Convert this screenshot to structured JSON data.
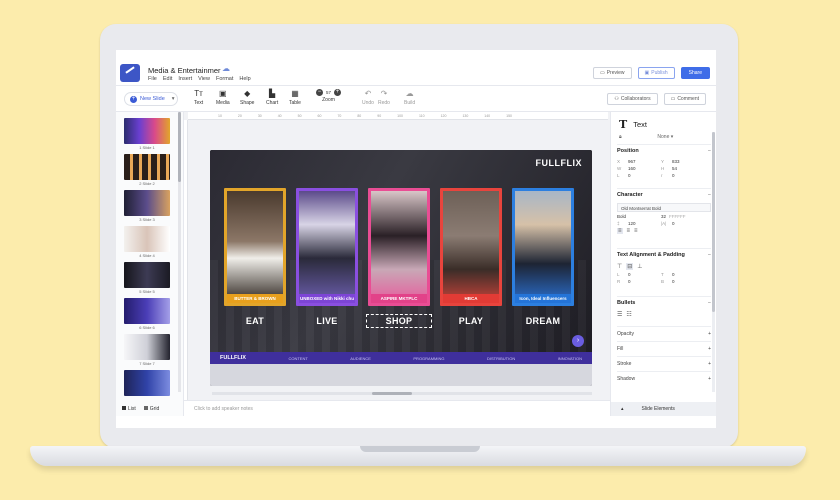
{
  "doc": {
    "title": "Media & Entertainmer"
  },
  "menu": [
    "File",
    "Edit",
    "Insert",
    "View",
    "Format",
    "Help"
  ],
  "top_actions": {
    "preview": "Preview",
    "publish": "Publish",
    "share": "Share"
  },
  "toolbar": {
    "new_slide": "New Slide",
    "text": "Text",
    "media": "Media",
    "shape": "Shape",
    "chart": "Chart",
    "table": "Table",
    "zoom_label": "Zoom",
    "zoom_value": "57",
    "undo": "Undo",
    "redo": "Redo",
    "build": "Build",
    "collaborators": "Collaborators",
    "comment": "Comment"
  },
  "slides": [
    {
      "label": "1 Slide 1"
    },
    {
      "label": "2 Slide 2"
    },
    {
      "label": "3 Slide 3"
    },
    {
      "label": "4 Slide 4"
    },
    {
      "label": "5 Slide 5"
    },
    {
      "label": "6 Slide 6"
    },
    {
      "label": "7 Slide 7"
    }
  ],
  "view_toggle": {
    "list": "List",
    "grid": "Grid"
  },
  "ruler": [
    "1",
    "10",
    "20",
    "30",
    "40",
    "50",
    "60",
    "70",
    "80",
    "90",
    "100",
    "110",
    "120",
    "130",
    "140",
    "150",
    "160",
    "170",
    "180",
    "190"
  ],
  "slide": {
    "brand": "FULLFLIX",
    "cards": [
      {
        "tag": "BUTTER & BROWN",
        "word": "EAT",
        "border": "#e2a52a",
        "tag_bg": "#e8a01d"
      },
      {
        "tag": "UNBOXED with Nikki chu",
        "word": "LIVE",
        "border": "#8a4fe0",
        "tag_bg": "#7d45d6"
      },
      {
        "tag": "ASPIRE MKTPLC",
        "word": "SHOP",
        "border": "#e94d94",
        "tag_bg": "#e24289"
      },
      {
        "tag": "HBCA",
        "word": "PLAY",
        "border": "#e8443d",
        "tag_bg": "#e23b35"
      },
      {
        "tag": "Icon, Ideal Influencers",
        "word": "DREAM",
        "border": "#2c7fe0",
        "tag_bg": "#2474d8"
      }
    ],
    "footer": {
      "brand": "FULLFLIX",
      "items": [
        "CONTENT",
        "AUDIENCE",
        "PROGRAMMING",
        "DISTRIBUTION",
        "INNOVATION"
      ]
    }
  },
  "speaker_notes_placeholder": "Click to add speaker notes",
  "props": {
    "panel_title": "Text",
    "lock_value": "None",
    "position": {
      "title": "Position",
      "x": "967",
      "y": "833",
      "w": "160",
      "h": "54",
      "l": "0",
      "r": "0"
    },
    "character": {
      "title": "Character",
      "font": "Old Montserrat Bold",
      "weight": "Bold",
      "size": "32",
      "color": "FFFFFF",
      "line": "120",
      "spacing": "0"
    },
    "alignment": {
      "title": "Text Alignment & Padding",
      "left": "0",
      "top": "0",
      "right": "0",
      "bottom": "0"
    },
    "bullets_title": "Bullets",
    "collapsed": [
      "Opacity",
      "Fill",
      "Stroke",
      "Shadow"
    ],
    "slide_elements": "Slide Elements"
  }
}
